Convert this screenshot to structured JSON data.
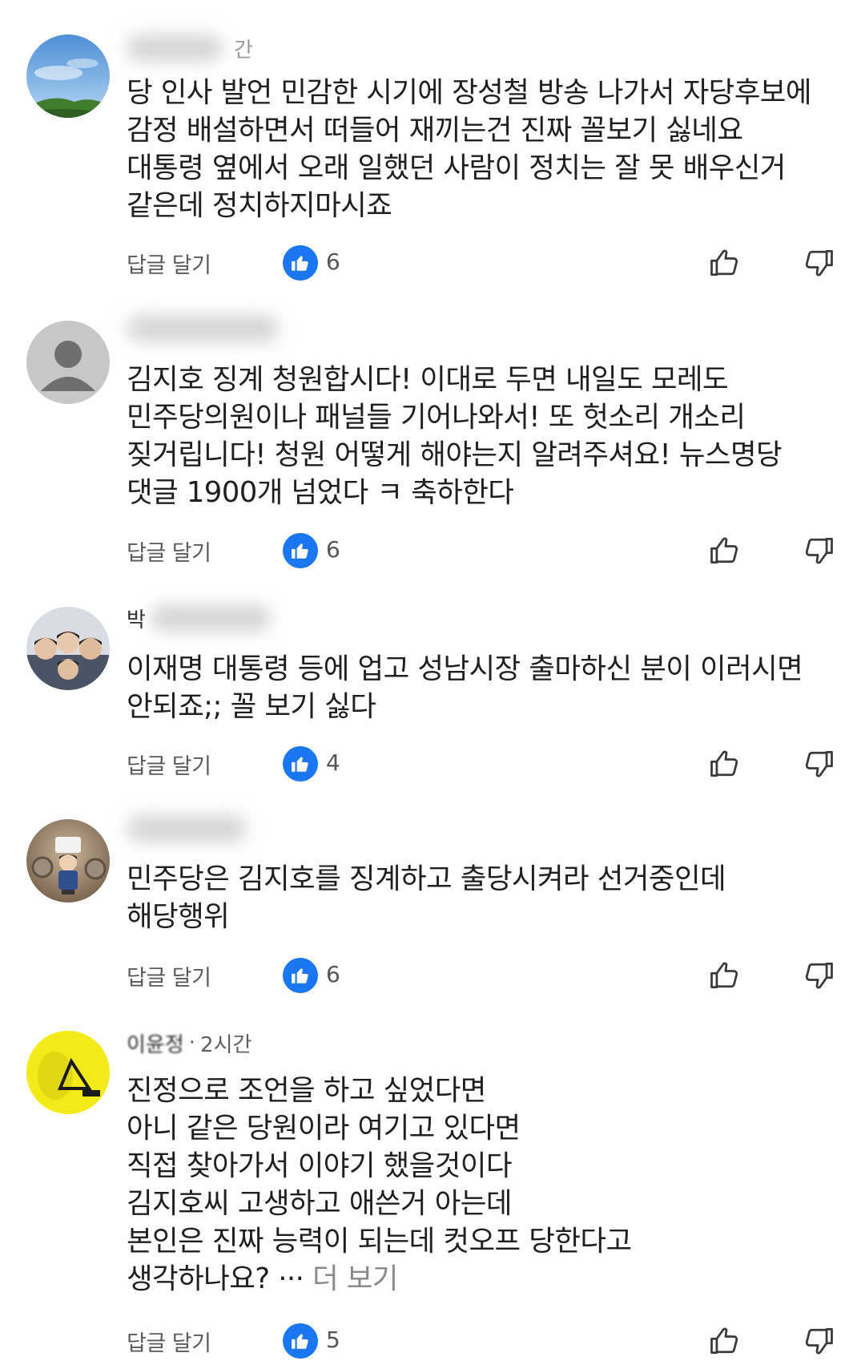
{
  "labels": {
    "reply": "답글 달기",
    "more": "더 보기"
  },
  "colors": {
    "like_badge": "#1b76f2",
    "text": "#1f1f1f",
    "meta": "#5f5f5f"
  },
  "comments": [
    {
      "author": "",
      "time": "간",
      "text": "당 인사 발언 민감한 시기에 장성철 방송 나가서 자당후보에\n감정 배설하면서 떠들어 재끼는건 진짜 꼴보기 싫네요\n대통령 옆에서 오래 일했던 사람이 정치는 잘 못 배우신거\n같은데 정치하지마시죠",
      "likes": "6",
      "avatar_icon": "sky-mountain-photo"
    },
    {
      "author": "",
      "time": "",
      "text": "김지호 징계 청원합시다! 이대로 두면 내일도 모레도\n민주당의원이나 패널들 기어나와서! 또 헛소리 개소리\n짖거립니다! 청원 어떻게 해야는지 알려주셔요! 뉴스명당\n댓글 1900개 넘었다 ㅋ 축하한다",
      "likes": "6",
      "avatar_icon": "default-person-icon"
    },
    {
      "author": "박",
      "time": "",
      "text": "이재명 대통령 등에 업고 성남시장 출마하신 분이 이러시면\n안되죠;; 꼴 보기 싫다",
      "likes": "4",
      "avatar_icon": "group-photo"
    },
    {
      "author": "",
      "time": "",
      "text": "민주당은 김지호를 징계하고 출당시켜라 선거중인데\n해당행위",
      "likes": "6",
      "avatar_icon": "figurine-photo"
    },
    {
      "author": "이윤정",
      "time": "2시간",
      "text": "진정으로 조언을 하고 싶었다면\n아니 같은 당원이라 여기고 있다면\n직접 찾아가서 이야기 했을것이다\n김지호씨 고생하고 애쓴거 아는데\n본인은 진짜 능력이 되는데 컷오프 당한다고\n생각하나요? ··· ",
      "likes": "5",
      "avatar_icon": "yellow-logo"
    }
  ]
}
